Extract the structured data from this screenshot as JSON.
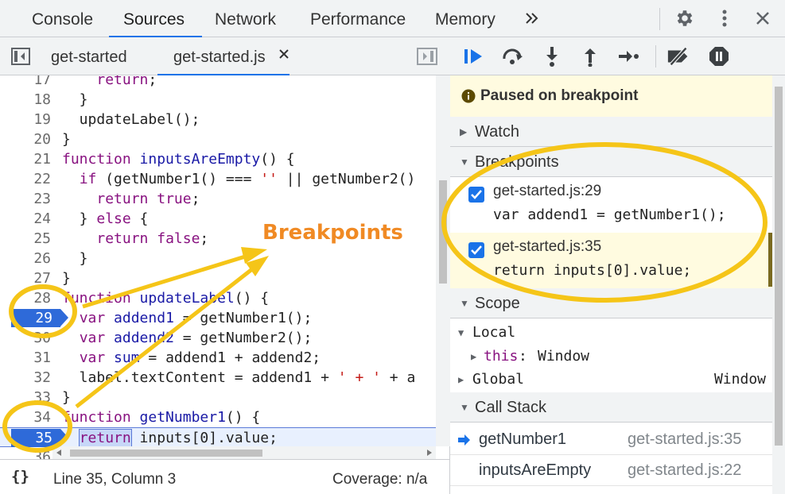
{
  "top_tabs": [
    "Console",
    "Sources",
    "Network",
    "Performance",
    "Memory"
  ],
  "top_icons": [
    "more-tabs-icon",
    "gear-icon",
    "kebab-menu-icon",
    "close-icon"
  ],
  "file_tabs": {
    "first": "get-started",
    "active": "get-started.js"
  },
  "code_lines": [
    {
      "n": "17",
      "text": "    return;"
    },
    {
      "n": "18",
      "text": "  }"
    },
    {
      "n": "19",
      "text": "  updateLabel();"
    },
    {
      "n": "20",
      "text": "}"
    },
    {
      "n": "21",
      "text": "function inputsAreEmpty() {"
    },
    {
      "n": "22",
      "text": "  if (getNumber1() === '' || getNumber2()"
    },
    {
      "n": "23",
      "text": "    return true;"
    },
    {
      "n": "24",
      "text": "  } else {"
    },
    {
      "n": "25",
      "text": "    return false;"
    },
    {
      "n": "26",
      "text": "  }"
    },
    {
      "n": "27",
      "text": "}"
    },
    {
      "n": "28",
      "text": "function updateLabel() {"
    },
    {
      "n": "29",
      "text": "  var addend1 = getNumber1();"
    },
    {
      "n": "30",
      "text": "  var addend2 = getNumber2();"
    },
    {
      "n": "31",
      "text": "  var sum = addend1 + addend2;"
    },
    {
      "n": "32",
      "text": "  label.textContent = addend1 + ' + ' + a"
    },
    {
      "n": "33",
      "text": "}"
    },
    {
      "n": "34",
      "text": "function getNumber1() {"
    },
    {
      "n": "35",
      "text": "  return inputs[0].value;"
    },
    {
      "n": "36",
      "text": ""
    }
  ],
  "status": {
    "format_icon": "{}",
    "position": "Line 35, Column 3",
    "coverage": "Coverage: n/a"
  },
  "paused_message": "Paused on breakpoint",
  "sections": {
    "watch": "Watch",
    "breakpoints": "Breakpoints",
    "scope": "Scope",
    "call_stack": "Call Stack"
  },
  "breakpoints": [
    {
      "file": "get-started.js:29",
      "code": "var addend1 = getNumber1();",
      "checked": true
    },
    {
      "file": "get-started.js:35",
      "code": "return inputs[0].value;",
      "checked": true
    }
  ],
  "scope": {
    "local": "Local",
    "this_key": "this",
    "this_val": "Window",
    "global": "Global",
    "global_val": "Window"
  },
  "call_stack": [
    {
      "fn": "getNumber1",
      "loc": "get-started.js:35"
    },
    {
      "fn": "inputsAreEmpty",
      "loc": "get-started.js:22"
    }
  ],
  "annotation": "Breakpoints",
  "colors": {
    "accent": "#1a73e8",
    "breakpoint": "#2e6ad9",
    "highlight": "#f5c518",
    "annotation": "#f08a24"
  }
}
